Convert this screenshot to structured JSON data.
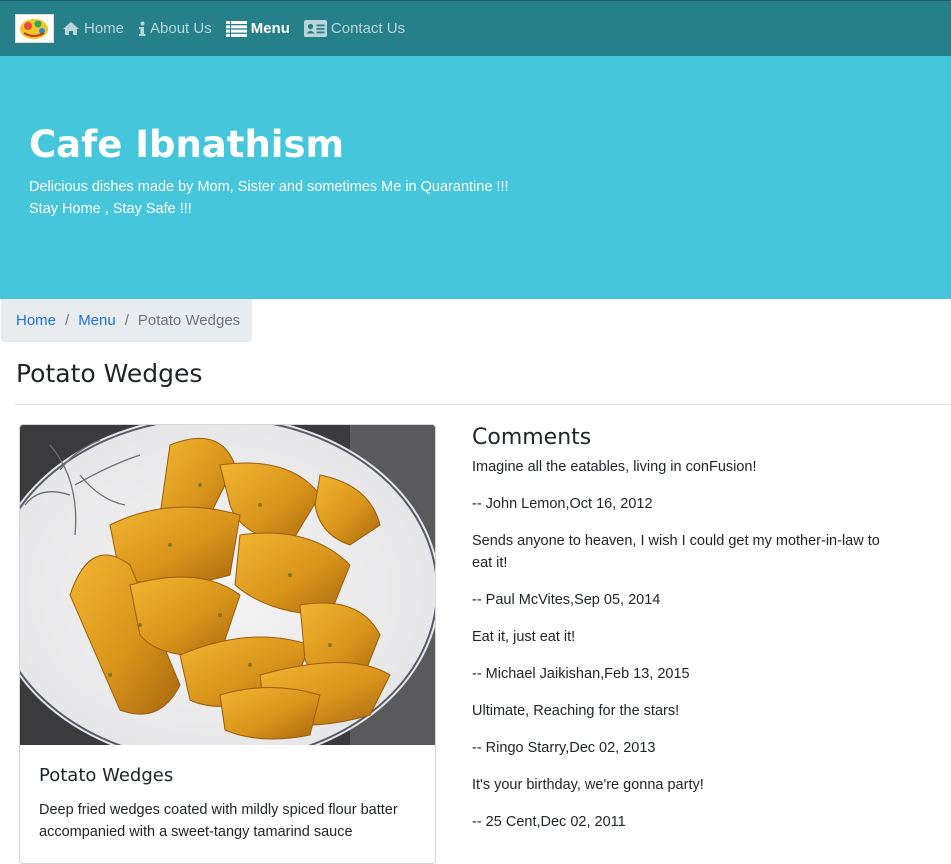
{
  "navbar": {
    "logo_icon": "cafe-logo-icon",
    "items": [
      {
        "label": "Home",
        "icon": "home-icon",
        "active": false
      },
      {
        "label": "About Us",
        "icon": "info-icon",
        "active": false
      },
      {
        "label": "Menu",
        "icon": "list-icon",
        "active": true
      },
      {
        "label": "Contact Us",
        "icon": "address-card-icon",
        "active": false
      }
    ]
  },
  "jumbotron": {
    "title": "Cafe Ibnathism",
    "tagline_line1": "Delicious dishes made by Mom, Sister and sometimes Me in Quarantine !!!",
    "tagline_line2": "Stay Home , Stay Safe !!!"
  },
  "breadcrumb": {
    "home": "Home",
    "menu": "Menu",
    "current": "Potato Wedges",
    "separator": "/"
  },
  "page": {
    "title": "Potato Wedges"
  },
  "dish": {
    "name": "Potato Wedges",
    "description": "Deep fried wedges coated with mildly spiced flour batter accompanied with a sweet-tangy tamarind sauce"
  },
  "comments": {
    "heading": "Comments",
    "items": [
      {
        "text": "Imagine all the eatables, living in conFusion!",
        "meta": "-- John Lemon,Oct 16, 2012"
      },
      {
        "text": "Sends anyone to heaven, I wish I could get my mother-in-law to eat it!",
        "meta": "-- Paul McVites,Sep 05, 2014"
      },
      {
        "text": "Eat it, just eat it!",
        "meta": "-- Michael Jaikishan,Feb 13, 2015"
      },
      {
        "text": "Ultimate, Reaching for the stars!",
        "meta": "-- Ringo Starry,Dec 02, 2013"
      },
      {
        "text": "It's your birthday, we're gonna party!",
        "meta": "-- 25 Cent,Dec 02, 2011"
      }
    ]
  },
  "colors": {
    "navbar_bg": "#26808a",
    "jumbotron_bg": "#45c6da",
    "link": "#1a73d9",
    "breadcrumb_bg": "#e9ecef"
  }
}
